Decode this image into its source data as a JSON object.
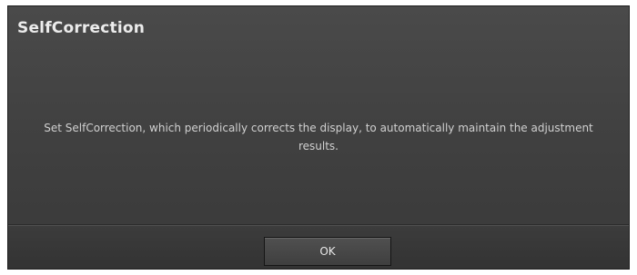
{
  "dialog": {
    "title": "SelfCorrection",
    "message": "Set SelfCorrection, which periodically corrects the display, to automatically maintain the adjustment results.",
    "ok_label": "OK"
  },
  "colors": {
    "background_top": "#4a4a4a",
    "background_bottom": "#393939",
    "title_text": "#ececec",
    "message_text": "#d0d0d0",
    "button_text": "#e8e8e8"
  }
}
